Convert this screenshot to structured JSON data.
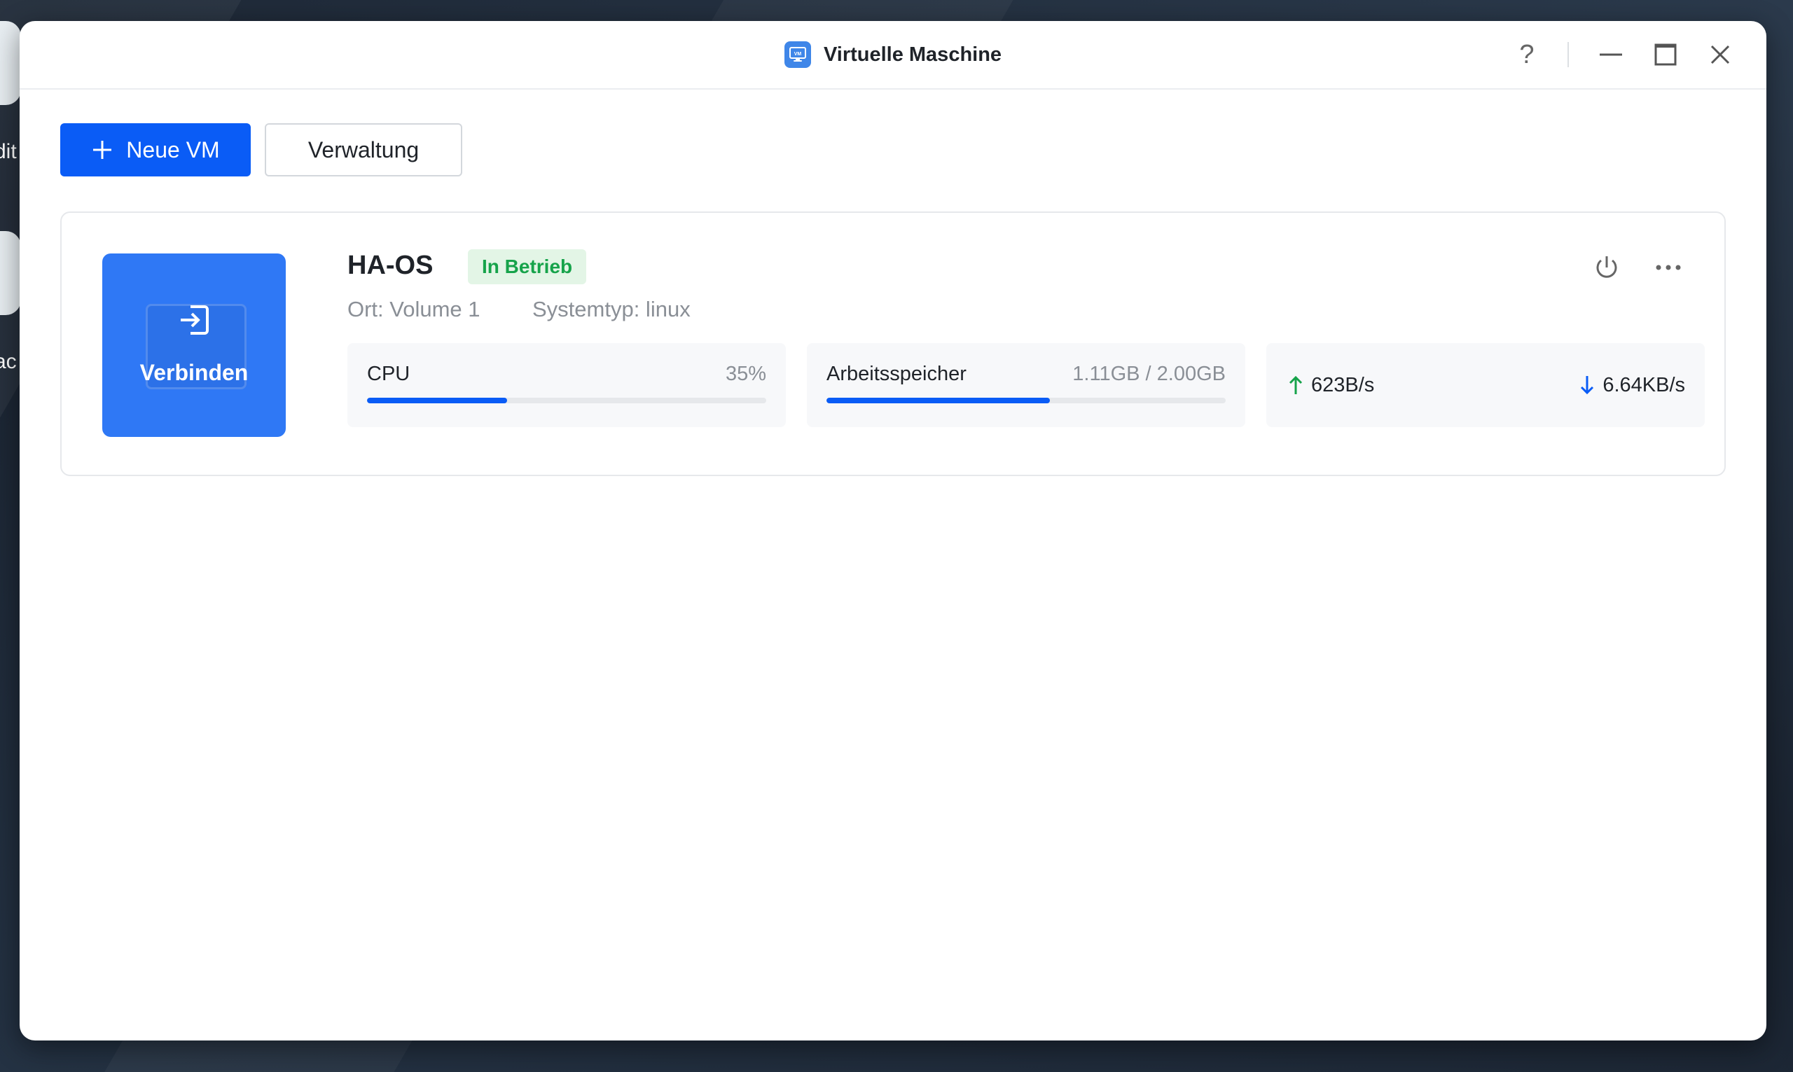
{
  "desktop": {
    "fragment_texts": [
      "dit",
      "ac"
    ]
  },
  "window": {
    "title": "Virtuelle Maschine",
    "icon": "vm-monitor-icon",
    "controls": [
      "help-icon",
      "minimize-icon",
      "maximize-icon",
      "close-icon"
    ],
    "help_label": "?"
  },
  "toolbar": {
    "new_vm_label": "Neue VM",
    "manage_label": "Verwaltung"
  },
  "vm": {
    "connect_label": "Verbinden",
    "name": "HA-OS",
    "status": "In Betrieb",
    "location": "Ort: Volume 1",
    "system_type": "Systemtyp: linux",
    "cpu": {
      "label": "CPU",
      "value": "35%",
      "fraction": 0.35
    },
    "memory": {
      "label": "Arbeitsspeicher",
      "value": "1.11GB / 2.00GB",
      "fraction": 0.56
    },
    "network": {
      "upload": "623B/s",
      "download": "6.64KB/s"
    }
  },
  "colors": {
    "accent": "#0a5cf6",
    "connect_tile": "#2f78f5",
    "status_green": "#16a34a",
    "status_bg": "#e3f5e6"
  }
}
